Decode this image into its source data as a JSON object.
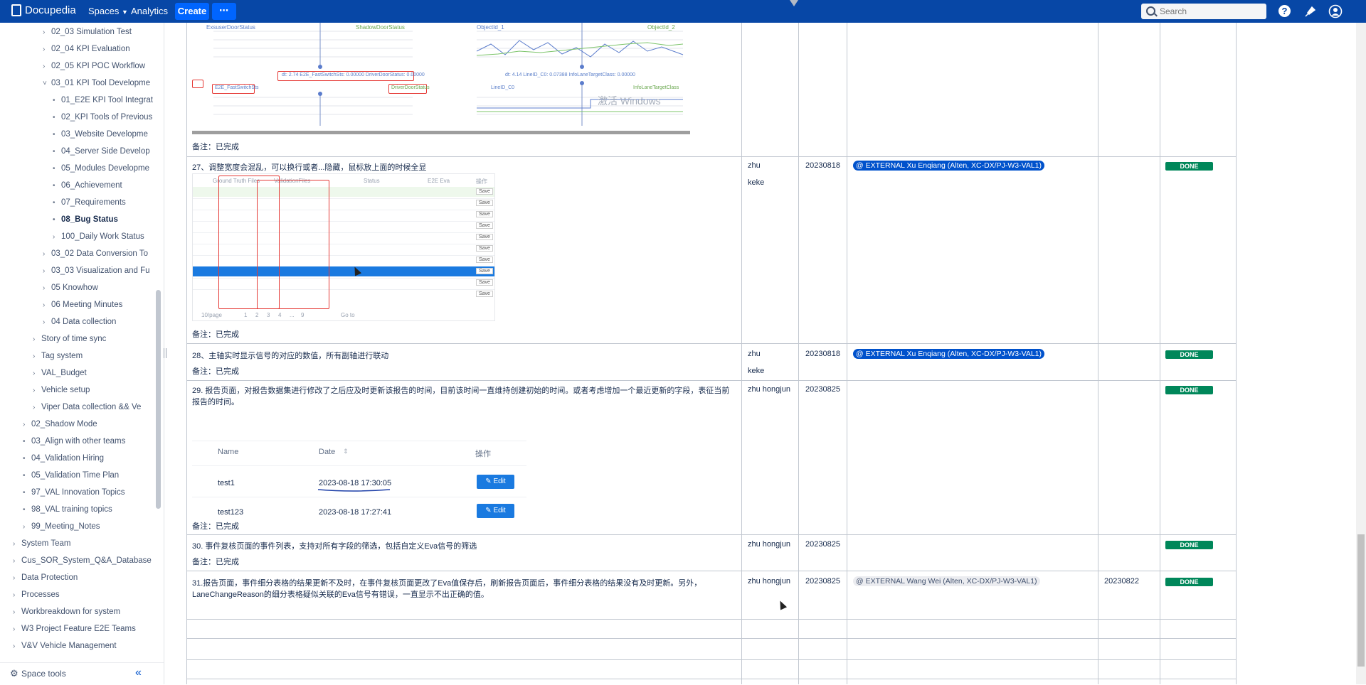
{
  "topnav": {
    "logo": "Docupedia",
    "spaces": "Spaces",
    "analytics": "Analytics",
    "create": "Create",
    "more": "⋯",
    "search_placeholder": "Search",
    "colors": {
      "nav_bg": "#0747a6",
      "create_bg": "#0065ff"
    }
  },
  "sidebar": {
    "items": [
      {
        "label": "02_03 Simulation Test",
        "twisty": "›"
      },
      {
        "label": "02_04 KPI Evaluation",
        "twisty": "›"
      },
      {
        "label": "02_05 KPI POC Workflow",
        "twisty": "›"
      },
      {
        "label": "03_01 KPI Tool Developme",
        "twisty": "˅"
      },
      {
        "label": "01_E2E KPI Tool Integrat",
        "twisty": "•"
      },
      {
        "label": "02_KPI Tools of Previous",
        "twisty": "•"
      },
      {
        "label": "03_Website Developme",
        "twisty": "•"
      },
      {
        "label": "04_Server Side Develop",
        "twisty": "•"
      },
      {
        "label": "05_Modules Developme",
        "twisty": "•"
      },
      {
        "label": "06_Achievement",
        "twisty": "•"
      },
      {
        "label": "07_Requirements",
        "twisty": "•"
      },
      {
        "label": "08_Bug Status",
        "twisty": "•"
      },
      {
        "label": "100_Daily Work Status",
        "twisty": "›"
      },
      {
        "label": "03_02 Data Conversion To",
        "twisty": "›"
      },
      {
        "label": "03_03 Visualization and Fu",
        "twisty": "›"
      },
      {
        "label": "05 Knowhow",
        "twisty": "›"
      },
      {
        "label": "06 Meeting Minutes",
        "twisty": "›"
      },
      {
        "label": "04 Data collection",
        "twisty": "›"
      },
      {
        "label": "Story of time sync",
        "twisty": "›"
      },
      {
        "label": "Tag system",
        "twisty": "›"
      },
      {
        "label": "VAL_Budget",
        "twisty": "›"
      },
      {
        "label": "Vehicle setup",
        "twisty": "›"
      },
      {
        "label": "Viper Data collection && Ve",
        "twisty": "›"
      },
      {
        "label": "02_Shadow Mode",
        "twisty": "›"
      },
      {
        "label": "03_Align with other teams",
        "twisty": "•"
      },
      {
        "label": "04_Validation Hiring",
        "twisty": "•"
      },
      {
        "label": "05_Validation Time Plan",
        "twisty": "•"
      },
      {
        "label": "97_VAL Innovation Topics",
        "twisty": "•"
      },
      {
        "label": "98_VAL training topics",
        "twisty": "•"
      },
      {
        "label": "99_Meeting_Notes",
        "twisty": "›"
      },
      {
        "label": "System Team",
        "twisty": "›"
      },
      {
        "label": "Cus_SOR_System_Q&A_Database",
        "twisty": "›"
      },
      {
        "label": "Data Protection",
        "twisty": "›"
      },
      {
        "label": "Processes",
        "twisty": "›"
      },
      {
        "label": "Workbreakdown for system",
        "twisty": "›"
      },
      {
        "label": "W3 Project Feature E2E Teams",
        "twisty": "›"
      },
      {
        "label": "V&V Vehicle Management",
        "twisty": "›"
      }
    ],
    "space_tools": "Space tools"
  },
  "rows": [
    {
      "note": "备注：已完成"
    },
    {
      "desc": "27、调整宽度会混乱，可以换行或者...隐藏，鼠标放上面的时候全显",
      "note": "备注：已完成",
      "owner_line1": "zhu",
      "owner_line2": "keke",
      "date": "20230818",
      "assignee": "@ EXTERNAL Xu Enqiang (Alten, XC-DX/PJ-W3-VAL1)",
      "status": "DONE"
    },
    {
      "desc": "28、主轴实时显示信号的对应的数值，所有副轴进行联动",
      "note": "备注：已完成",
      "owner_line1": "zhu",
      "owner_line2": "keke",
      "date": "20230818",
      "assignee": "@ EXTERNAL Xu Enqiang (Alten, XC-DX/PJ-W3-VAL1)",
      "status": "DONE"
    },
    {
      "desc": "29. 报告页面，对报告数据集进行修改了之后应及时更新该报告的时间，目前该时间一直维持创建初始的时间。或者考虑增加一个最近更新的字段，表征当前报告的时间。",
      "note": "备注：已完成",
      "owner": "zhu hongjun",
      "date": "20230825",
      "status": "DONE",
      "embedded_table": {
        "headers": [
          "Name",
          "Date",
          "操作"
        ],
        "rows": [
          {
            "name": "test1",
            "date": "2023-08-18 17:30:05",
            "action": "Edit"
          },
          {
            "name": "test123",
            "date": "2023-08-18 17:27:41",
            "action": "Edit"
          }
        ]
      }
    },
    {
      "desc": "30. 事件复核页面的事件列表，支持对所有字段的筛选，包括自定义Eva信号的筛选",
      "note": "备注：已完成",
      "owner": "zhu hongjun",
      "date": "20230825",
      "status": "DONE"
    },
    {
      "desc_line1": "31.报告页面，事件细分表格的结果更新不及时，在事件复核页面更改了Eva值保存后，刷新报告页面后，事件细分表格的结果没有及时更新。另外，",
      "desc_line2": "LaneChangeReason的细分表格疑似关联的Eva信号有错误，一直显示不出正确的值。",
      "owner": "zhu hongjun",
      "date": "20230825",
      "assignee": "@ EXTERNAL Wang Wei (Alten, XC-DX/PJ-W3-VAL1)",
      "date2": "20230822",
      "status": "DONE"
    }
  ],
  "screenshot_top": {
    "labels": [
      "ExsuserDoorStatus",
      "ShadowDoorStatus",
      "ObjectId_1",
      "ObjectId_2",
      "激活 Windows"
    ],
    "readout_left": "dt: 2.74  E2E_FastSwitchSts: 0.00000  DriverDoorStatus: 0.00000",
    "readout_right": "dt: 4.14  LineID_C0: 0.07388  InfoLaneTargetClass: 0.00000",
    "tag_left_a": "E2E_FastSwitchSts",
    "tag_left_b": "DriverDoorStatus",
    "tag_right_a": "LineID_C0",
    "tag_right_b": "InfoLaneTargetClass"
  },
  "screenshot_grid": {
    "headers": [
      "Ground Truth Files",
      "ValidationFiles",
      "Status",
      "E2E Eva",
      "操作"
    ],
    "save_label": "Save",
    "pager": "10/page",
    "pages": [
      "1",
      "2",
      "3",
      "4",
      "...",
      "9"
    ],
    "goto": "Go to"
  }
}
